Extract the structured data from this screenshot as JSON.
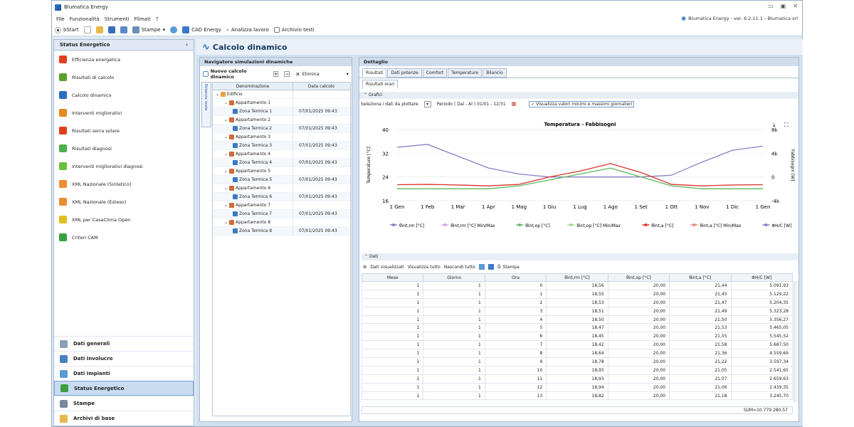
{
  "window": {
    "title": "Blumatica Energy",
    "version": "Blumatica Energy - ver. 6.2.11.1 - Blumatica srl"
  },
  "menu": [
    "File",
    "Funzionalità",
    "Strumenti",
    "Filmati",
    "?"
  ],
  "toolbar": {
    "bstart": "bStart",
    "stampe": "Stampe",
    "cad": "CAD Energy",
    "analizza": "Analizza lavoro",
    "archivio": "Archivio testi"
  },
  "sidebar": {
    "header": "Status Energetico",
    "items": [
      {
        "label": "Efficienza energetica",
        "color": "#e04020"
      },
      {
        "label": "Risultati di calcolo",
        "color": "#5aa02c"
      },
      {
        "label": "Calcolo dinamico",
        "color": "#2a6fc0"
      },
      {
        "label": "Interventi migliorativi",
        "color": "#e08a20"
      },
      {
        "label": "Risultati serra solare",
        "color": "#e04020"
      },
      {
        "label": "Risultati diagnosi",
        "color": "#4caf50"
      },
      {
        "label": "Interventi migliorativi diagnosi",
        "color": "#6abf3a"
      },
      {
        "label": "XML Nazionale (Sintetico)",
        "color": "#f08c30"
      },
      {
        "label": "XML Nazionale (Esteso)",
        "color": "#f08c30"
      },
      {
        "label": "XML per CasaClima Open",
        "color": "#e0c020"
      },
      {
        "label": "Criteri CAM",
        "color": "#3aa040"
      }
    ],
    "bottom": [
      {
        "label": "Dati generali",
        "active": false
      },
      {
        "label": "Dati Involucro",
        "active": false
      },
      {
        "label": "Dati Impianti",
        "active": false
      },
      {
        "label": "Status Energetico",
        "active": true
      },
      {
        "label": "Stampe",
        "active": false
      },
      {
        "label": "Archivi di base",
        "active": false
      }
    ]
  },
  "main": {
    "title": "Calcolo dinamico"
  },
  "nav": {
    "header": "Navigatore simulazioni dinamiche",
    "new_btn": "Nuovo calcolo dinamico",
    "delete_btn": "Elimina",
    "side_tab": "Potenza reale",
    "col_name": "Denominazione",
    "col_date": "Data calcolo",
    "rows": [
      {
        "name": "Edificio",
        "date": "",
        "level": 0
      },
      {
        "name": "Appartamento 1",
        "date": "",
        "level": 1
      },
      {
        "name": "Zona Termica 1",
        "date": "07/01/2025 09:43",
        "level": 2
      },
      {
        "name": "Appartamento 2",
        "date": "",
        "level": 1
      },
      {
        "name": "Zona Termica 2",
        "date": "07/01/2025 09:43",
        "level": 2
      },
      {
        "name": "Appartamento 3",
        "date": "",
        "level": 1
      },
      {
        "name": "Zona Termica 3",
        "date": "07/01/2025 09:43",
        "level": 2
      },
      {
        "name": "Appartamento 4",
        "date": "",
        "level": 1
      },
      {
        "name": "Zona Termica 4",
        "date": "07/01/2025 09:43",
        "level": 2
      },
      {
        "name": "Appartamento 5",
        "date": "",
        "level": 1
      },
      {
        "name": "Zona Termica 5",
        "date": "07/01/2025 09:43",
        "level": 2
      },
      {
        "name": "Appartamento 6",
        "date": "",
        "level": 1
      },
      {
        "name": "Zona Termica 6",
        "date": "07/01/2025 09:43",
        "level": 2
      },
      {
        "name": "Appartamento 7",
        "date": "",
        "level": 1
      },
      {
        "name": "Zona Termica 7",
        "date": "07/01/2025 09:43",
        "level": 2
      },
      {
        "name": "Appartamento 8",
        "date": "",
        "level": 1
      },
      {
        "name": "Zona Termica 8",
        "date": "07/01/2025 09:43",
        "level": 2
      }
    ]
  },
  "detail": {
    "header": "Dettaglio",
    "tabs": [
      "Risultati",
      "Dati potenze",
      "Comfort",
      "Temperature",
      "Bilancio"
    ],
    "subtab": "Risultati orari",
    "grafici": "Grafici",
    "select_label": "Seleziona i dati da plottare",
    "period_label": "Periodo ( Dal - Al ) 01/01 - 12/31",
    "checkbox_label": "Visualizza valori minimi e massimi giornalieri",
    "dati": "Dati",
    "grid_toolbar": {
      "shown": "Dati visualizzati",
      "show_all": "Visualizza tutto",
      "hide_all": "Nascondi tutto",
      "print": "Stampa"
    },
    "columns": [
      "Mese",
      "Giorno",
      "Ora",
      "θint,rm [°C]",
      "θint,op [°C]",
      "θint,a [°C]",
      "ΦH/C [W]"
    ],
    "rows": [
      [
        "1",
        "1",
        "0",
        "18,56",
        "20,00",
        "21,44",
        "5.091,93"
      ],
      [
        "1",
        "1",
        "1",
        "18,55",
        "20,00",
        "21,45",
        "5.129,22"
      ],
      [
        "1",
        "1",
        "2",
        "18,53",
        "20,00",
        "21,47",
        "5.204,35"
      ],
      [
        "1",
        "1",
        "3",
        "18,51",
        "20,00",
        "21,49",
        "5.323,28"
      ],
      [
        "1",
        "1",
        "4",
        "18,50",
        "20,00",
        "21,50",
        "5.356,27"
      ],
      [
        "1",
        "1",
        "5",
        "18,47",
        "20,00",
        "21,53",
        "5.465,05"
      ],
      [
        "1",
        "1",
        "6",
        "18,45",
        "20,00",
        "21,55",
        "5.545,52"
      ],
      [
        "1",
        "1",
        "7",
        "18,42",
        "20,00",
        "21,58",
        "5.687,50"
      ],
      [
        "1",
        "1",
        "8",
        "18,64",
        "20,00",
        "21,36",
        "4.559,69"
      ],
      [
        "1",
        "1",
        "9",
        "18,78",
        "20,00",
        "21,22",
        "3.597,34"
      ],
      [
        "1",
        "1",
        "10",
        "18,95",
        "20,00",
        "21,05",
        "2.541,65"
      ],
      [
        "1",
        "1",
        "11",
        "18,93",
        "20,00",
        "21,07",
        "2.659,63"
      ],
      [
        "1",
        "1",
        "12",
        "18,94",
        "20,00",
        "21,06",
        "2.439,35"
      ],
      [
        "1",
        "1",
        "13",
        "18,82",
        "20,00",
        "21,18",
        "3.245,70"
      ]
    ],
    "sum": "SUM=10.779.280,57"
  },
  "chart_data": {
    "type": "line",
    "title": "Temperatura - Fabbisogni",
    "ylabel": "Temperature [°C]",
    "y2label": "Fabbisogni [W]",
    "ylim": [
      16,
      40
    ],
    "yticks": [
      16,
      24,
      32,
      40
    ],
    "y2lim": [
      -4000,
      8000
    ],
    "y2ticks": [
      "-4k",
      "0",
      "4k",
      "8k"
    ],
    "categories": [
      "1 Gen",
      "1 Feb",
      "1 Mar",
      "1 Apr",
      "1 Mag",
      "1 Giu",
      "1 Lug",
      "1 Ago",
      "1 Set",
      "1 Ott",
      "1 Nov",
      "1 Dic",
      "1 Gen"
    ],
    "series": [
      {
        "name": "θint,rm [°C]",
        "color": "#8a7cc4",
        "axis": "y2",
        "values": [
          5000,
          5500,
          3500,
          1500,
          500,
          0,
          0,
          0,
          0,
          300,
          2500,
          4500,
          5200
        ]
      },
      {
        "name": "θint,op [°C]",
        "color": "#5cb85c",
        "values": [
          20,
          20,
          20,
          20,
          21,
          23,
          25,
          27,
          24,
          21,
          20,
          20,
          20
        ]
      },
      {
        "name": "θint,a [°C]",
        "color": "#d9342b",
        "values": [
          21.4,
          21.5,
          21.3,
          21,
          21.5,
          24,
          26,
          28.5,
          25.5,
          21.5,
          21,
          21.3,
          21.4
        ]
      }
    ],
    "legend": [
      "θint,rm [°C]",
      "θint,rm [°C] Min/Max",
      "θint,op [°C]",
      "θint,op [°C] Min/Max",
      "θint,a [°C]",
      "θint,a [°C] Min/Max",
      "ΦH/C [W]",
      "ΦH/C [W] Min/Max"
    ],
    "legend_colors": [
      "#8a7cc4",
      "#c9a8e0",
      "#5cb85c",
      "#a8d88a",
      "#d9342b",
      "#e8867f",
      "#8a7cc4",
      "#b7a8de"
    ]
  }
}
